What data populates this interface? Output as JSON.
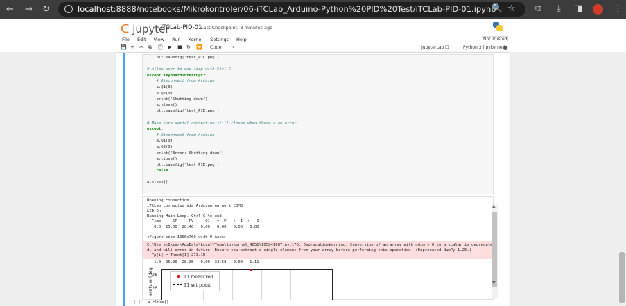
{
  "browser": {
    "url_host": "localhost",
    "url_rest": ":8888/notebooks/Mikrokontroler/06-iTCLab_Arduino-Python%20PID%20Test/iTCLab-PID-01.ipynb",
    "back_icon": "←",
    "forward_icon": "→",
    "reload_icon": "↻",
    "zoom_icon": "🔍",
    "star_icon": "☆",
    "ext_icon": "⧉",
    "download_icon": "⤓",
    "panel_icon": "◨",
    "menu_icon": "⋮"
  },
  "jupyter": {
    "logo": "jupyter",
    "notebook_name": "iTCLab-PID-01",
    "checkpoint": "Last Checkpoint: 8 minutes ago",
    "menu": [
      "File",
      "Edit",
      "View",
      "Run",
      "Kernel",
      "Settings",
      "Help"
    ],
    "trust": "Not Trusted",
    "cell_type": "Code",
    "jupyterlab_link": "JupyterLab ☐",
    "kernel": "Python 3 (ipykernel)",
    "tools": [
      "💾",
      "+",
      "✂",
      "⧉",
      "📋",
      "▶",
      "■",
      "↻",
      "⏩"
    ]
  },
  "code_lines": [
    {
      "t": "    plt.savefig('test_PID.png')",
      "c": ""
    },
    {
      "t": "",
      "c": ""
    },
    {
      "t": "# Allow user to end loop with Ctrl-C",
      "c": "cm"
    },
    {
      "t": "except KeyboardInterrupt:",
      "c": "kw"
    },
    {
      "t": "    # Disconnect from Arduino",
      "c": "cm"
    },
    {
      "t": "    a.Q1(0)",
      "c": ""
    },
    {
      "t": "    a.Q2(0)",
      "c": ""
    },
    {
      "t": "    print('Shutting down')",
      "c": ""
    },
    {
      "t": "    a.close()",
      "c": ""
    },
    {
      "t": "    plt.savefig('test_PID.png')",
      "c": ""
    },
    {
      "t": "",
      "c": ""
    },
    {
      "t": "# Make sure serial connection still closes when there's an error",
      "c": "cm"
    },
    {
      "t": "except:",
      "c": "kw"
    },
    {
      "t": "    # Disconnect from Arduino",
      "c": "cm"
    },
    {
      "t": "    a.Q1(0)",
      "c": ""
    },
    {
      "t": "    a.Q2(0)",
      "c": ""
    },
    {
      "t": "    print('Error: Shutting down')",
      "c": ""
    },
    {
      "t": "    a.close()",
      "c": ""
    },
    {
      "t": "    plt.savefig('test_PID.png')",
      "c": ""
    },
    {
      "t": "    raise",
      "c": "kw"
    },
    {
      "t": "",
      "c": ""
    },
    {
      "t": "a.close()",
      "c": ""
    }
  ],
  "output": {
    "lines": [
      "Opening connection",
      "iTCLab connected via Arduino on port COM3",
      "LED On",
      "Running Main Loop. Ctrl-C to end.",
      "  Time     SP     PV     Q1   =  P   +  I  +   D",
      "   0.0  25.00  28.46   0.00   0.00   0.00   0.00",
      "",
      "<Figure size 1000x700 with 0 Axes>"
    ],
    "warning": "C:\\Users\\Ikzar\\AppData\\Local\\Temp\\ipykernel_4052\\105841687.py:170: DeprecationWarning: Conversion of an array with ndim > 0 to a scalar is deprecate\nd, and will error in future. Ensure you extract a single element from your array before performing this operation. (Deprecated NumPy 1.25.)\n  Tp[i] = Tnext[1]-273.15",
    "after": "   1.0  25.00  28.35   0.00 -33.58   0.00   1.11"
  },
  "figure": {
    "legend_measured": "T1 measured",
    "legend_setpoint": "T1 set point",
    "ylabel": "erature (deg",
    "yticks": [
      "28",
      "26"
    ]
  },
  "next_cell": {
    "prompt": "[ ]:",
    "code": "a.close()"
  }
}
